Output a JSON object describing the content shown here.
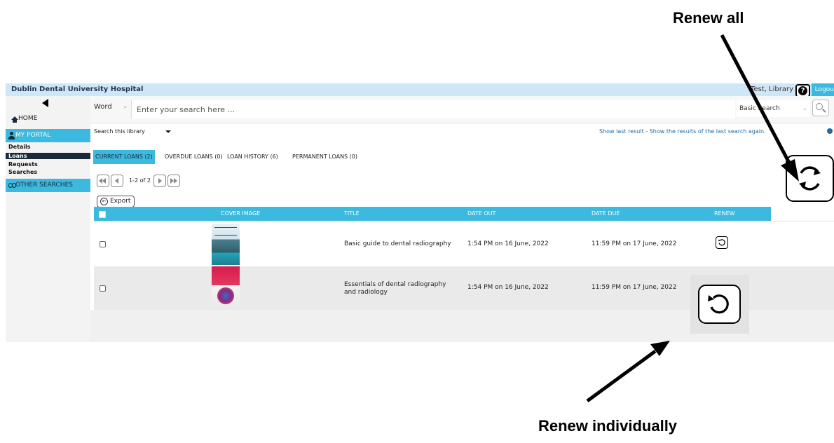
{
  "annotations": {
    "renew_all": "Renew all",
    "renew_individually": "Renew individually"
  },
  "header": {
    "org_name": "Dublin Dental University Hospital",
    "user_name": "Test, Library",
    "help_icon": "?",
    "logout_label": "Logout"
  },
  "sidebar": {
    "home_label": "HOME",
    "portal_label": "MY PORTAL",
    "portal_items": [
      "Details",
      "Loans",
      "Requests",
      "Searches"
    ],
    "active_item": "Loans",
    "other_searches_label": "OTHER SEARCHES"
  },
  "search": {
    "type_value": "Word",
    "placeholder": "Enter your search here ...",
    "mode_value": "Basic Search",
    "scope_value": "Search this library",
    "last_result_text": "Show last result - Show the results of the last search again."
  },
  "tabs": [
    {
      "label": "CURRENT LOANS (2)",
      "active": true
    },
    {
      "label": "OVERDUE LOANS (0)",
      "active": false
    },
    {
      "label": "LOAN HISTORY (6)",
      "active": false
    },
    {
      "label": "PERMANENT LOANS (0)",
      "active": false
    }
  ],
  "pagination": {
    "info": "1-2 of 2"
  },
  "toolbar": {
    "export_label": "Export"
  },
  "table": {
    "columns": [
      "COVER IMAGE",
      "TITLE",
      "DATE OUT",
      "DATE DUE",
      "RENEW"
    ],
    "rows": [
      {
        "title": "Basic guide to dental radiography",
        "date_out": "1:54 PM on 16 June, 2022",
        "date_due": "11:59 PM on 17 June, 2022",
        "renew_icon": "renew-icon"
      },
      {
        "title": "Essentials of dental radiography and radiology",
        "date_out": "1:54 PM on 16 June, 2022",
        "date_due": "11:59 PM on 17 June, 2022",
        "renew_icon": "renew-icon"
      }
    ]
  },
  "colors": {
    "accent": "#3bb9de",
    "header_bg": "#cfe6f6",
    "nav_dark": "#1b2a3a"
  }
}
